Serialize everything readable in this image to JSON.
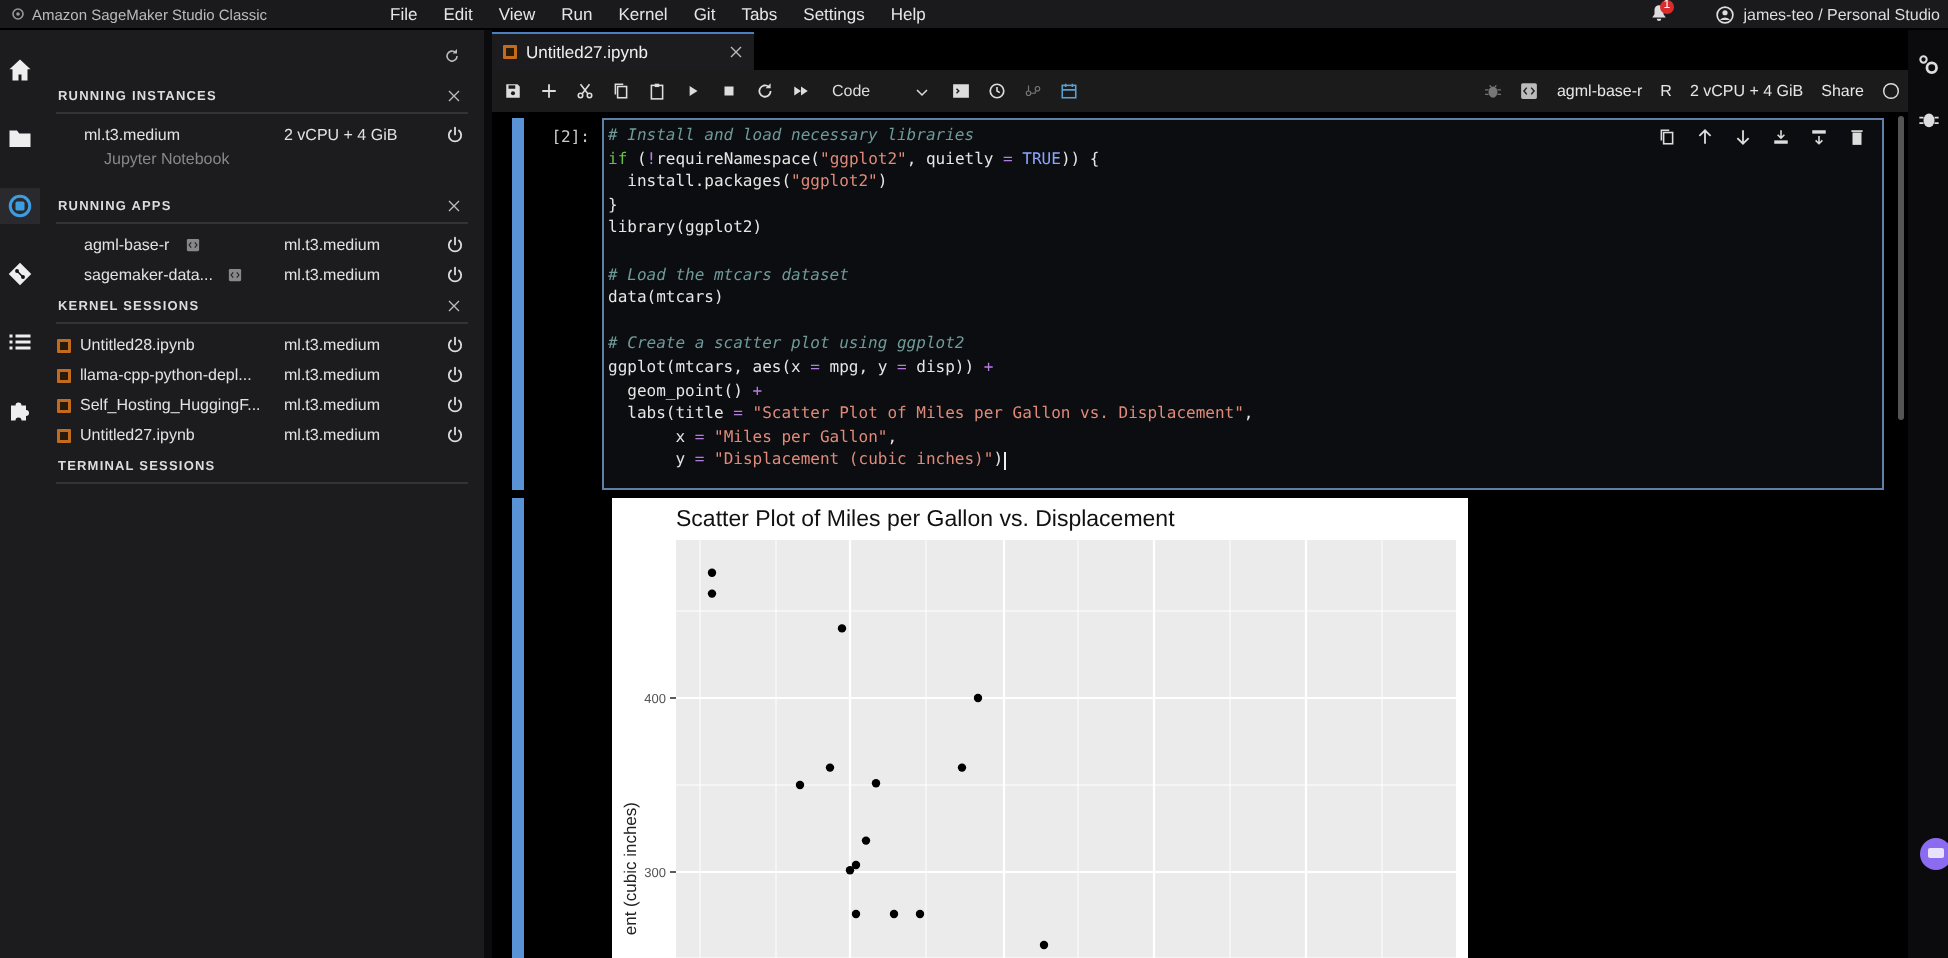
{
  "topbar": {
    "app_title": "Amazon SageMaker Studio Classic",
    "menus": [
      "File",
      "Edit",
      "View",
      "Run",
      "Kernel",
      "Git",
      "Tabs",
      "Settings",
      "Help"
    ],
    "notification_count": "1",
    "user": "james-teo / Personal Studio"
  },
  "activity_bar": [
    {
      "kind": "home",
      "selected": false
    },
    {
      "kind": "folder",
      "selected": false
    },
    {
      "kind": "running",
      "selected": true
    },
    {
      "kind": "git",
      "selected": false
    },
    {
      "kind": "list",
      "selected": false
    },
    {
      "kind": "extension",
      "selected": false
    }
  ],
  "running_panel": {
    "sections": [
      {
        "title": "RUNNING INSTANCES",
        "closable": true,
        "items": [
          {
            "kind": "instance",
            "name": "ml.t3.medium",
            "detail": "2 vCPU + 4 GiB",
            "subtitle": "Jupyter Notebook"
          }
        ]
      },
      {
        "title": "RUNNING APPS",
        "closable": true,
        "items": [
          {
            "kind": "app",
            "name": "agml-base-r",
            "detail": "ml.t3.medium"
          },
          {
            "kind": "app",
            "name": "sagemaker-data...",
            "detail": "ml.t3.medium"
          }
        ]
      },
      {
        "title": "KERNEL SESSIONS",
        "closable": true,
        "items": [
          {
            "kind": "notebook",
            "name": "Untitled28.ipynb",
            "detail": "ml.t3.medium"
          },
          {
            "kind": "notebook",
            "name": "llama-cpp-python-depl...",
            "detail": "ml.t3.medium"
          },
          {
            "kind": "notebook",
            "name": "Self_Hosting_HuggingF...",
            "detail": "ml.t3.medium"
          },
          {
            "kind": "notebook",
            "name": "Untitled27.ipynb",
            "detail": "ml.t3.medium"
          }
        ]
      },
      {
        "title": "TERMINAL SESSIONS",
        "closable": false
      }
    ]
  },
  "tabs": [
    {
      "label": "Untitled27.ipynb",
      "selected": true
    }
  ],
  "toolbar": {
    "cell_type": "Code",
    "kernel_name": "agml-base-r",
    "kernel_language": "R",
    "instance": "2 vCPU + 4 GiB",
    "share": "Share"
  },
  "cell": {
    "prompt": "[2]:",
    "lines": [
      {
        "kind": "code",
        "tokens": [
          {
            "kind": "comment",
            "text": "# Install and load necessary libraries"
          }
        ]
      },
      {
        "kind": "code",
        "tokens": [
          {
            "kind": "keyword",
            "text": "if"
          },
          {
            "kind": "plain",
            "text": " ("
          },
          {
            "kind": "operator",
            "text": "!"
          },
          {
            "kind": "plain",
            "text": "requireNamespace("
          },
          {
            "kind": "string",
            "text": "\"ggplot2\""
          },
          {
            "kind": "plain",
            "text": ", quietly "
          },
          {
            "kind": "operator",
            "text": "= "
          },
          {
            "kind": "constant",
            "text": "TRUE"
          },
          {
            "kind": "plain",
            "text": ")) {"
          }
        ]
      },
      {
        "kind": "code",
        "tokens": [
          {
            "kind": "plain",
            "text": "  install.packages("
          },
          {
            "kind": "string",
            "text": "\"ggplot2\""
          },
          {
            "kind": "plain",
            "text": ")"
          }
        ]
      },
      {
        "kind": "code",
        "tokens": [
          {
            "kind": "plain",
            "text": "}"
          }
        ]
      },
      {
        "kind": "code",
        "tokens": [
          {
            "kind": "plain",
            "text": "library(ggplot2)"
          }
        ]
      },
      {
        "kind": "blank"
      },
      {
        "kind": "code",
        "tokens": [
          {
            "kind": "comment",
            "text": "# Load the mtcars dataset"
          }
        ]
      },
      {
        "kind": "code",
        "tokens": [
          {
            "kind": "plain",
            "text": "data(mtcars)"
          }
        ]
      },
      {
        "kind": "blank"
      },
      {
        "kind": "code",
        "tokens": [
          {
            "kind": "comment",
            "text": "# Create a scatter plot using ggplot2"
          }
        ]
      },
      {
        "kind": "code",
        "tokens": [
          {
            "kind": "plain",
            "text": "ggplot(mtcars, aes(x "
          },
          {
            "kind": "operator",
            "text": "="
          },
          {
            "kind": "plain",
            "text": " mpg, y "
          },
          {
            "kind": "operator",
            "text": "="
          },
          {
            "kind": "plain",
            "text": " disp)) "
          },
          {
            "kind": "operator",
            "text": "+"
          }
        ]
      },
      {
        "kind": "code",
        "tokens": [
          {
            "kind": "plain",
            "text": "  geom_point() "
          },
          {
            "kind": "operator",
            "text": "+"
          }
        ]
      },
      {
        "kind": "code",
        "tokens": [
          {
            "kind": "plain",
            "text": "  labs(title "
          },
          {
            "kind": "operator",
            "text": "= "
          },
          {
            "kind": "string",
            "text": "\"Scatter Plot of Miles per Gallon vs. Displacement\""
          },
          {
            "kind": "plain",
            "text": ","
          }
        ]
      },
      {
        "kind": "code",
        "tokens": [
          {
            "kind": "plain",
            "text": "       x "
          },
          {
            "kind": "operator",
            "text": "= "
          },
          {
            "kind": "string",
            "text": "\"Miles per Gallon\""
          },
          {
            "kind": "plain",
            "text": ","
          }
        ]
      },
      {
        "kind": "code",
        "tokens": [
          {
            "kind": "plain",
            "text": "       y "
          },
          {
            "kind": "operator",
            "text": "= "
          },
          {
            "kind": "string",
            "text": "\"Displacement (cubic inches)\""
          },
          {
            "kind": "plain",
            "text": ")"
          }
        ]
      }
    ]
  },
  "output": {
    "plot": {
      "title": "Scatter Plot of Miles per Gallon vs. Displacement",
      "y_axis_label": "ent (cubic inches)",
      "y_tick_labels": [
        "400",
        "300"
      ]
    }
  }
}
